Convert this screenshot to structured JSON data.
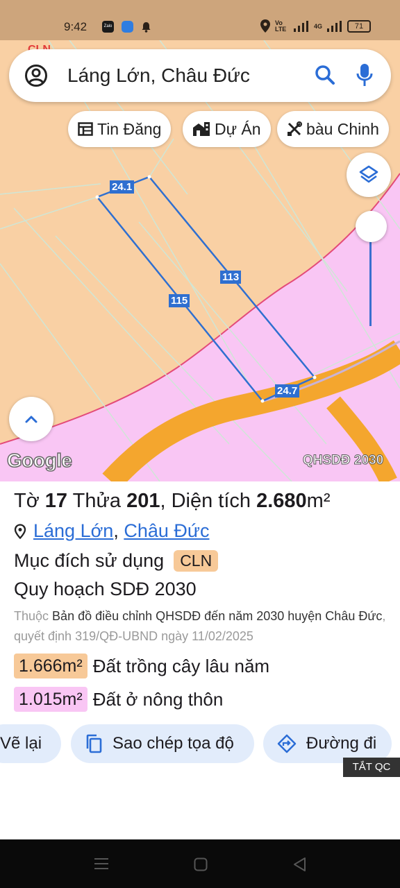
{
  "status_bar": {
    "time": "9:42",
    "app_icons": [
      "zalo-icon",
      "browser-icon",
      "notification-bell-icon"
    ],
    "network_labels": "Vo LTE",
    "network_type": "4G",
    "battery": "71"
  },
  "search": {
    "query": "Láng Lớn, Châu Đức"
  },
  "chips": [
    {
      "icon": "listing-icon",
      "label": "Tin Đăng"
    },
    {
      "icon": "project-building-icon",
      "label": "Dự Án"
    },
    {
      "icon": "tools-icon",
      "label": "bàu Chinh"
    }
  ],
  "map": {
    "plot_dimensions": {
      "top": "24.1",
      "right": "113",
      "left": "115",
      "bottom": "24.7"
    },
    "google_logo": "Google",
    "layer_tag": "QHSDĐ 2030",
    "colors": {
      "cln_land": "#f9d0a4",
      "rural_residential": "#f9c6f4",
      "road": "#f4a62e",
      "plot_outline": "#2f6fd0"
    }
  },
  "details": {
    "title_sheet_label": "Tờ",
    "sheet_no": "17",
    "title_parcel_label": "Thửa",
    "parcel_no": "201",
    "title_area_label": "Diện tích",
    "area_value": "2.680",
    "area_unit": "m²",
    "location_ward": "Láng Lớn",
    "location_separator": ",",
    "location_district": "Châu Đức",
    "purpose_label": "Mục đích sử dụng",
    "purpose_code": "CLN",
    "plan_title": "Quy hoạch SDĐ 2030",
    "desc_prefix": "Thuộc",
    "desc_main": "Bản đồ điều chỉnh QHSDĐ đến năm 2030 huyện Châu Đức",
    "desc_decision": ", quyết định 319/QĐ-UBND ngày 11/02/2025",
    "area_breakdown": [
      {
        "value": "1.666m²",
        "label": "Đất trồng cây lâu năm",
        "color": "#f7c998"
      },
      {
        "value": "1.015m²",
        "label": "Đất ở nông thôn",
        "color": "#f9c6f4"
      }
    ]
  },
  "actions": [
    {
      "icon": "redraw-icon",
      "label": "Vẽ lại"
    },
    {
      "icon": "copy-icon",
      "label": "Sao chép tọa độ"
    },
    {
      "icon": "directions-icon",
      "label": "Đường đi"
    }
  ],
  "ad": {
    "close_ads_label": "TẮT QC"
  }
}
